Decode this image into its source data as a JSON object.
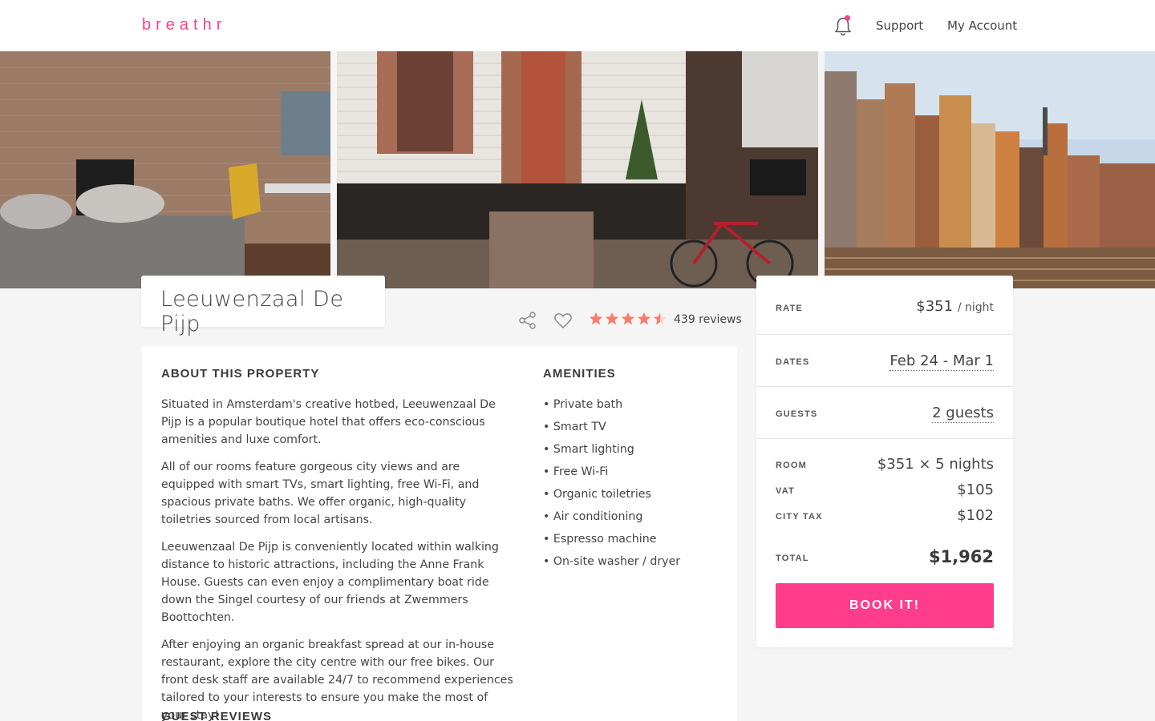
{
  "header": {
    "logo": "breathr",
    "nav": [
      {
        "label": "Support"
      },
      {
        "label": "My Account"
      }
    ]
  },
  "property": {
    "name": "Leeuwenzaal De Pijp",
    "rating": 4.5,
    "reviews_label": "439 reviews"
  },
  "about": {
    "heading": "ABOUT THIS PROPERTY",
    "paragraphs": [
      "Situated in Amsterdam's creative hotbed, Leeuwenzaal De Pijp is a popular boutique hotel that offers eco-conscious amenities and luxe comfort.",
      "All of our rooms feature gorgeous city views and are equipped with smart TVs, smart lighting, free Wi-Fi, and spacious private baths. We offer organic, high-quality toiletries sourced from local artisans.",
      "Leeuwenzaal De Pijp is conveniently located within walking distance to historic attractions, including the Anne Frank House. Guests can even enjoy a complimentary boat ride down the Singel courtesy of our friends at Zwemmers Boottochten.",
      "After enjoying an organic breakfast spread at our in-house restaurant, explore the city centre with our free bikes. Our front desk staff are available 24/7 to recommend experiences tailored to your interests to ensure you make the most of your stay!"
    ]
  },
  "amenities": {
    "heading": "AMENITIES",
    "items": [
      "Private bath",
      "Smart TV",
      "Smart lighting",
      "Free Wi-Fi",
      "Organic toiletries",
      "Air conditioning",
      "Espresso machine",
      "On-site washer / dryer"
    ]
  },
  "reviews": {
    "heading": "GUEST REVIEWS"
  },
  "booking": {
    "rate_label": "RATE",
    "rate_value": "$351",
    "rate_unit": "/ night",
    "dates_label": "DATES",
    "dates_value": "Feb 24 - Mar 1",
    "guests_label": "GUESTS",
    "guests_value": "2 guests",
    "room_label": "ROOM",
    "room_value": "$351 × 5 nights",
    "vat_label": "VAT",
    "vat_value": "$105",
    "citytax_label": "CITY TAX",
    "citytax_value": "$102",
    "total_label": "TOTAL",
    "total_value": "$1,962",
    "button_label": "BOOK IT!"
  },
  "colors": {
    "accent": "#ff3d8b",
    "star": "#ff7a68"
  },
  "icons": [
    "bell-icon",
    "share-icon",
    "heart-icon",
    "star-icon"
  ]
}
